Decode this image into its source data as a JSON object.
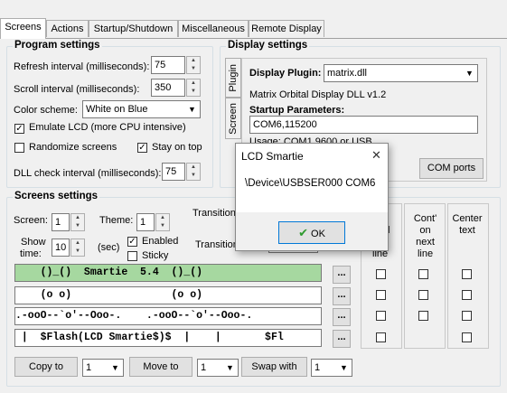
{
  "tabs": [
    "Screens",
    "Actions",
    "Startup/Shutdown",
    "Miscellaneous",
    "Remote Display"
  ],
  "program_settings": {
    "title": "Program settings",
    "refresh_label": "Refresh interval (milliseconds):",
    "refresh_value": "75",
    "scroll_label": "Scroll interval (milliseconds):",
    "scroll_value": "350",
    "color_label": "Color scheme:",
    "color_value": "White on Blue",
    "emulate_label": "Emulate LCD  (more CPU intensive)",
    "emulate_checked": true,
    "randomize_label": "Randomize screens",
    "randomize_checked": false,
    "stayontop_label": "Stay on top",
    "stayontop_checked": true,
    "dll_label": "DLL check interval (milliseconds):",
    "dll_value": "75"
  },
  "display_settings": {
    "title": "Display settings",
    "vtab_plugin": "Plugin",
    "vtab_screen": "Screen",
    "plugin_label": "Display Plugin:",
    "plugin_value": "matrix.dll",
    "plugin_desc": "Matrix Orbital Display DLL v1.2",
    "startup_label": "Startup Parameters:",
    "startup_value": "COM6,115200",
    "usage_text": "Usage: COM1,9600 or USB",
    "com_ports_button": "COM ports"
  },
  "screens_settings": {
    "title": "Screens settings",
    "screen_label": "Screen:",
    "screen_value": "1",
    "theme_label": "Theme:",
    "theme_value": "1",
    "transition_label": "Transition",
    "transition_label2": "Transition",
    "show_label": "Show",
    "time_label": "time:",
    "show_value": "10",
    "sec_label": "(sec)",
    "enabled_label": "Enabled",
    "enabled_checked": true,
    "sticky_label": "Sticky",
    "sticky_checked": false,
    "lines": [
      "    ()_()  Smartie  5.4  ()_()",
      "    (o o)                (o o)",
      ".-ooO--`o'--Ooo-.    .-ooO--`o'--Ooo-.",
      " |  $Flash(LCD Smartie$)$  |    |       $Fl"
    ],
    "dots_label": "...",
    "col_partial_1": "t",
    "col_partial_2": "l",
    "col_line_label": "line",
    "col_cont": [
      "Cont'",
      "on",
      "next",
      "line"
    ],
    "col_center": [
      "Center",
      "text"
    ],
    "copy_button": "Copy to",
    "copy_value": "1",
    "move_button": "Move to",
    "move_value": "1",
    "swap_button": "Swap with",
    "swap_value": "1"
  },
  "dialog": {
    "title": "LCD Smartie",
    "message": "\\Device\\USBSER000 COM6",
    "ok_label": "OK",
    "close_glyph": "✕"
  },
  "colors": {
    "highlight_line": "#a6d8a0",
    "ok_check": "#2e9a2e"
  }
}
